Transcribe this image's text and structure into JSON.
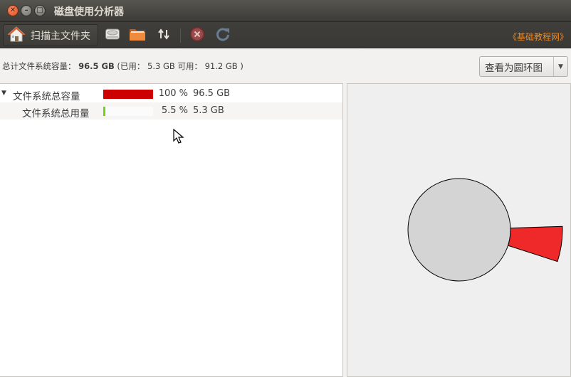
{
  "window": {
    "title": "磁盘使用分析器"
  },
  "toolbar": {
    "home_label": "扫描主文件夹",
    "brand": "《基础教程网》",
    "icons": [
      "home-icon",
      "drive-icon",
      "folder-icon",
      "sort-arrows-icon",
      "stop-icon",
      "refresh-icon"
    ]
  },
  "infobar": {
    "prefix": "总计文件系统容量：",
    "total": "96.5 GB",
    "used_part": "(已用：  5.3 GB 可用：  91.2 GB )",
    "view_button": "查看为圆环图"
  },
  "tree": {
    "rows": [
      {
        "name": "文件系统总容量",
        "percent_text": "100 %",
        "size": "96.5 GB",
        "fraction": 1.0,
        "color": "#cc0000",
        "expanded": true
      },
      {
        "name": "文件系统总用量",
        "percent_text": "5.5 %",
        "size": "5.3 GB",
        "fraction": 0.055,
        "color": "#73d216"
      }
    ]
  },
  "chart": {
    "colors": {
      "circle": "#d3d4d3",
      "used_ring": "#ef2929"
    },
    "used_fraction": 0.055
  },
  "colors": {
    "brand": "#e88a2a",
    "titlebar": "#3c3b37"
  }
}
